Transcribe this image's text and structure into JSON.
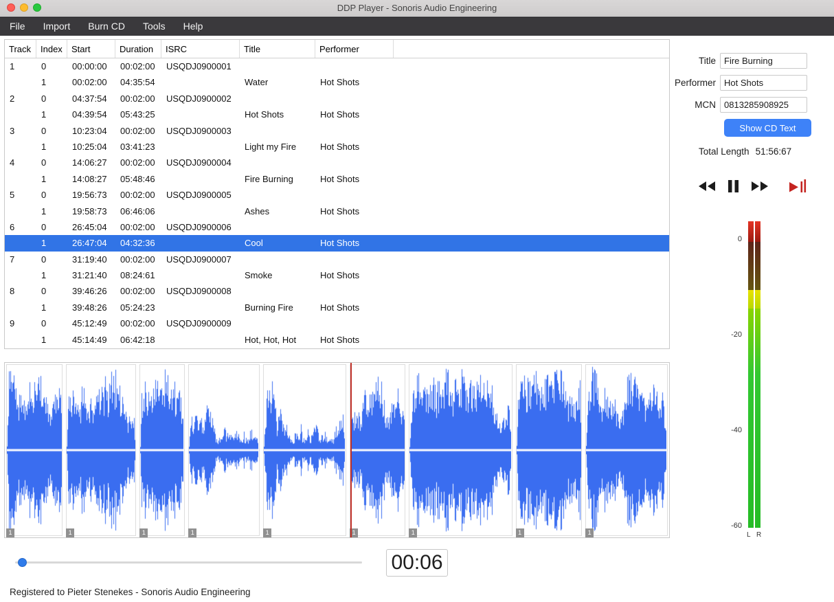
{
  "window": {
    "title": "DDP Player - Sonoris Audio Engineering"
  },
  "menu": {
    "items": [
      "File",
      "Import",
      "Burn CD",
      "Tools",
      "Help"
    ]
  },
  "track_table": {
    "columns": [
      "Track",
      "Index",
      "Start",
      "Duration",
      "ISRC",
      "Title",
      "Performer"
    ],
    "rows": [
      {
        "track": "1",
        "index": "0",
        "start": "00:00:00",
        "duration": "00:02:00",
        "isrc": "USQDJ0900001",
        "title": "",
        "performer": "",
        "selected": false
      },
      {
        "track": "",
        "index": "1",
        "start": "00:02:00",
        "duration": "04:35:54",
        "isrc": "",
        "title": "Water",
        "performer": "Hot Shots",
        "selected": false
      },
      {
        "track": "2",
        "index": "0",
        "start": "04:37:54",
        "duration": "00:02:00",
        "isrc": "USQDJ0900002",
        "title": "",
        "performer": "",
        "selected": false
      },
      {
        "track": "",
        "index": "1",
        "start": "04:39:54",
        "duration": "05:43:25",
        "isrc": "",
        "title": "Hot Shots",
        "performer": "Hot Shots",
        "selected": false
      },
      {
        "track": "3",
        "index": "0",
        "start": "10:23:04",
        "duration": "00:02:00",
        "isrc": "USQDJ0900003",
        "title": "",
        "performer": "",
        "selected": false
      },
      {
        "track": "",
        "index": "1",
        "start": "10:25:04",
        "duration": "03:41:23",
        "isrc": "",
        "title": "Light my Fire",
        "performer": "Hot Shots",
        "selected": false
      },
      {
        "track": "4",
        "index": "0",
        "start": "14:06:27",
        "duration": "00:02:00",
        "isrc": "USQDJ0900004",
        "title": "",
        "performer": "",
        "selected": false
      },
      {
        "track": "",
        "index": "1",
        "start": "14:08:27",
        "duration": "05:48:46",
        "isrc": "",
        "title": "Fire Burning",
        "performer": "Hot Shots",
        "selected": false
      },
      {
        "track": "5",
        "index": "0",
        "start": "19:56:73",
        "duration": "00:02:00",
        "isrc": "USQDJ0900005",
        "title": "",
        "performer": "",
        "selected": false
      },
      {
        "track": "",
        "index": "1",
        "start": "19:58:73",
        "duration": "06:46:06",
        "isrc": "",
        "title": "Ashes",
        "performer": "Hot Shots",
        "selected": false
      },
      {
        "track": "6",
        "index": "0",
        "start": "26:45:04",
        "duration": "00:02:00",
        "isrc": "USQDJ0900006",
        "title": "",
        "performer": "",
        "selected": false
      },
      {
        "track": "",
        "index": "1",
        "start": "26:47:04",
        "duration": "04:32:36",
        "isrc": "",
        "title": "Cool",
        "performer": "Hot Shots",
        "selected": true
      },
      {
        "track": "7",
        "index": "0",
        "start": "31:19:40",
        "duration": "00:02:00",
        "isrc": "USQDJ0900007",
        "title": "",
        "performer": "",
        "selected": false
      },
      {
        "track": "",
        "index": "1",
        "start": "31:21:40",
        "duration": "08:24:61",
        "isrc": "",
        "title": "Smoke",
        "performer": "Hot Shots",
        "selected": false
      },
      {
        "track": "8",
        "index": "0",
        "start": "39:46:26",
        "duration": "00:02:00",
        "isrc": "USQDJ0900008",
        "title": "",
        "performer": "",
        "selected": false
      },
      {
        "track": "",
        "index": "1",
        "start": "39:48:26",
        "duration": "05:24:23",
        "isrc": "",
        "title": "Burning Fire",
        "performer": "Hot Shots",
        "selected": false
      },
      {
        "track": "9",
        "index": "0",
        "start": "45:12:49",
        "duration": "00:02:00",
        "isrc": "USQDJ0900009",
        "title": "",
        "performer": "",
        "selected": false
      },
      {
        "track": "",
        "index": "1",
        "start": "45:14:49",
        "duration": "06:42:18",
        "isrc": "",
        "title": "Hot, Hot, Hot",
        "performer": "Hot Shots",
        "selected": false
      }
    ]
  },
  "side_panel": {
    "title_label": "Title",
    "title_value": "Fire Burning",
    "performer_label": "Performer",
    "performer_value": "Hot Shots",
    "mcn_label": "MCN",
    "mcn_value": "0813285908925",
    "show_cd_text_label": "Show CD Text",
    "total_length_label": "Total Length",
    "total_length_value": "51:56:67"
  },
  "transport": {
    "icons": [
      "rewind-icon",
      "pause-icon",
      "fast-forward-icon",
      "play-to-marker-icon"
    ]
  },
  "meter": {
    "scale_labels": [
      "0",
      "-20",
      "-40",
      "-60"
    ],
    "channel_labels": "L R"
  },
  "waveform": {
    "index_marker_label": "1",
    "playhead_track_number": 6
  },
  "time_display": "00:06",
  "status_bar": "Registered to Pieter Stenekes - Sonoris Audio Engineering",
  "colors": {
    "selection": "#3174e6",
    "accent_button": "#3e82f8",
    "waveform": "#3a6df0",
    "playhead": "#c03028",
    "meter_green": "#2cc42c",
    "meter_yellow": "#e0dc00",
    "meter_red": "#d42818"
  }
}
